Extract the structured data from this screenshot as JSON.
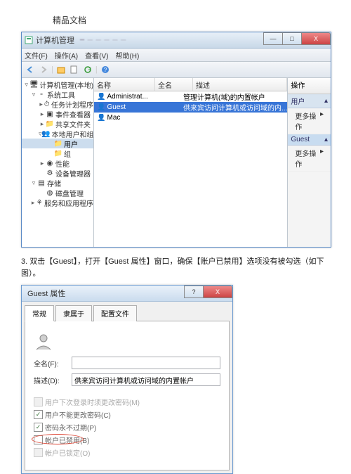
{
  "doc_title": "精品文档",
  "window": {
    "title": "计算机管理",
    "menu": [
      "文件(F)",
      "操作(A)",
      "查看(V)",
      "帮助(H)"
    ],
    "win_buttons": {
      "min": "—",
      "max": "□",
      "close": "X"
    }
  },
  "tree": {
    "root": "计算机管理(本地)",
    "items": [
      {
        "exp": "▿",
        "label": "系统工具"
      },
      {
        "exp": "▸",
        "label": "任务计划程序",
        "ind": 2,
        "icon": "clock"
      },
      {
        "exp": "▸",
        "label": "事件查看器",
        "ind": 2,
        "icon": "event"
      },
      {
        "exp": "▸",
        "label": "共享文件夹",
        "ind": 2,
        "icon": "folder"
      },
      {
        "exp": "▿",
        "label": "本地用户和组",
        "ind": 2,
        "icon": "users"
      },
      {
        "exp": "",
        "label": "用户",
        "ind": 3,
        "icon": "folder",
        "sel": true
      },
      {
        "exp": "",
        "label": "组",
        "ind": 3,
        "icon": "folder"
      },
      {
        "exp": "▸",
        "label": "性能",
        "ind": 2,
        "icon": "perf"
      },
      {
        "exp": "",
        "label": "设备管理器",
        "ind": 2,
        "icon": "device"
      },
      {
        "exp": "▿",
        "label": "存储",
        "ind": 1,
        "icon": "storage"
      },
      {
        "exp": "",
        "label": "磁盘管理",
        "ind": 2,
        "icon": "disk"
      },
      {
        "exp": "▸",
        "label": "服务和应用程序",
        "ind": 1,
        "icon": "service"
      }
    ]
  },
  "list": {
    "headers": [
      "名称",
      "全名",
      "描述"
    ],
    "rows": [
      {
        "name": "Administrat...",
        "full": "",
        "desc": "管理计算机(域)的内置帐户"
      },
      {
        "name": "Guest",
        "full": "",
        "desc": "供来宾访问计算机或访问域的内...",
        "sel": true
      },
      {
        "name": "Mac",
        "full": "",
        "desc": ""
      }
    ]
  },
  "actions": {
    "header": "操作",
    "sec1": "用户",
    "item1": "更多操作",
    "sec2": "Guest",
    "item2": "更多操作",
    "arrow": "▸",
    "chev": "▴"
  },
  "step": "3. 双击【Guest】，打开【Guest 属性】窗口，确保【账户已禁用】选项没有被勾选（如下图）。",
  "dialog": {
    "title": "Guest 属性",
    "tabs": [
      "常规",
      "隶属于",
      "配置文件"
    ],
    "fullname_label": "全名(F):",
    "fullname_value": "",
    "desc_label": "描述(D):",
    "desc_value": "供来宾访问计算机或访问域的内置帐户",
    "chk1": "用户下次登录时须更改密码(M)",
    "chk2": "用户不能更改密码(C)",
    "chk3": "密码永不过期(P)",
    "chk4": "帐户已禁用(B)",
    "chk5": "帐户已锁定(O)"
  }
}
